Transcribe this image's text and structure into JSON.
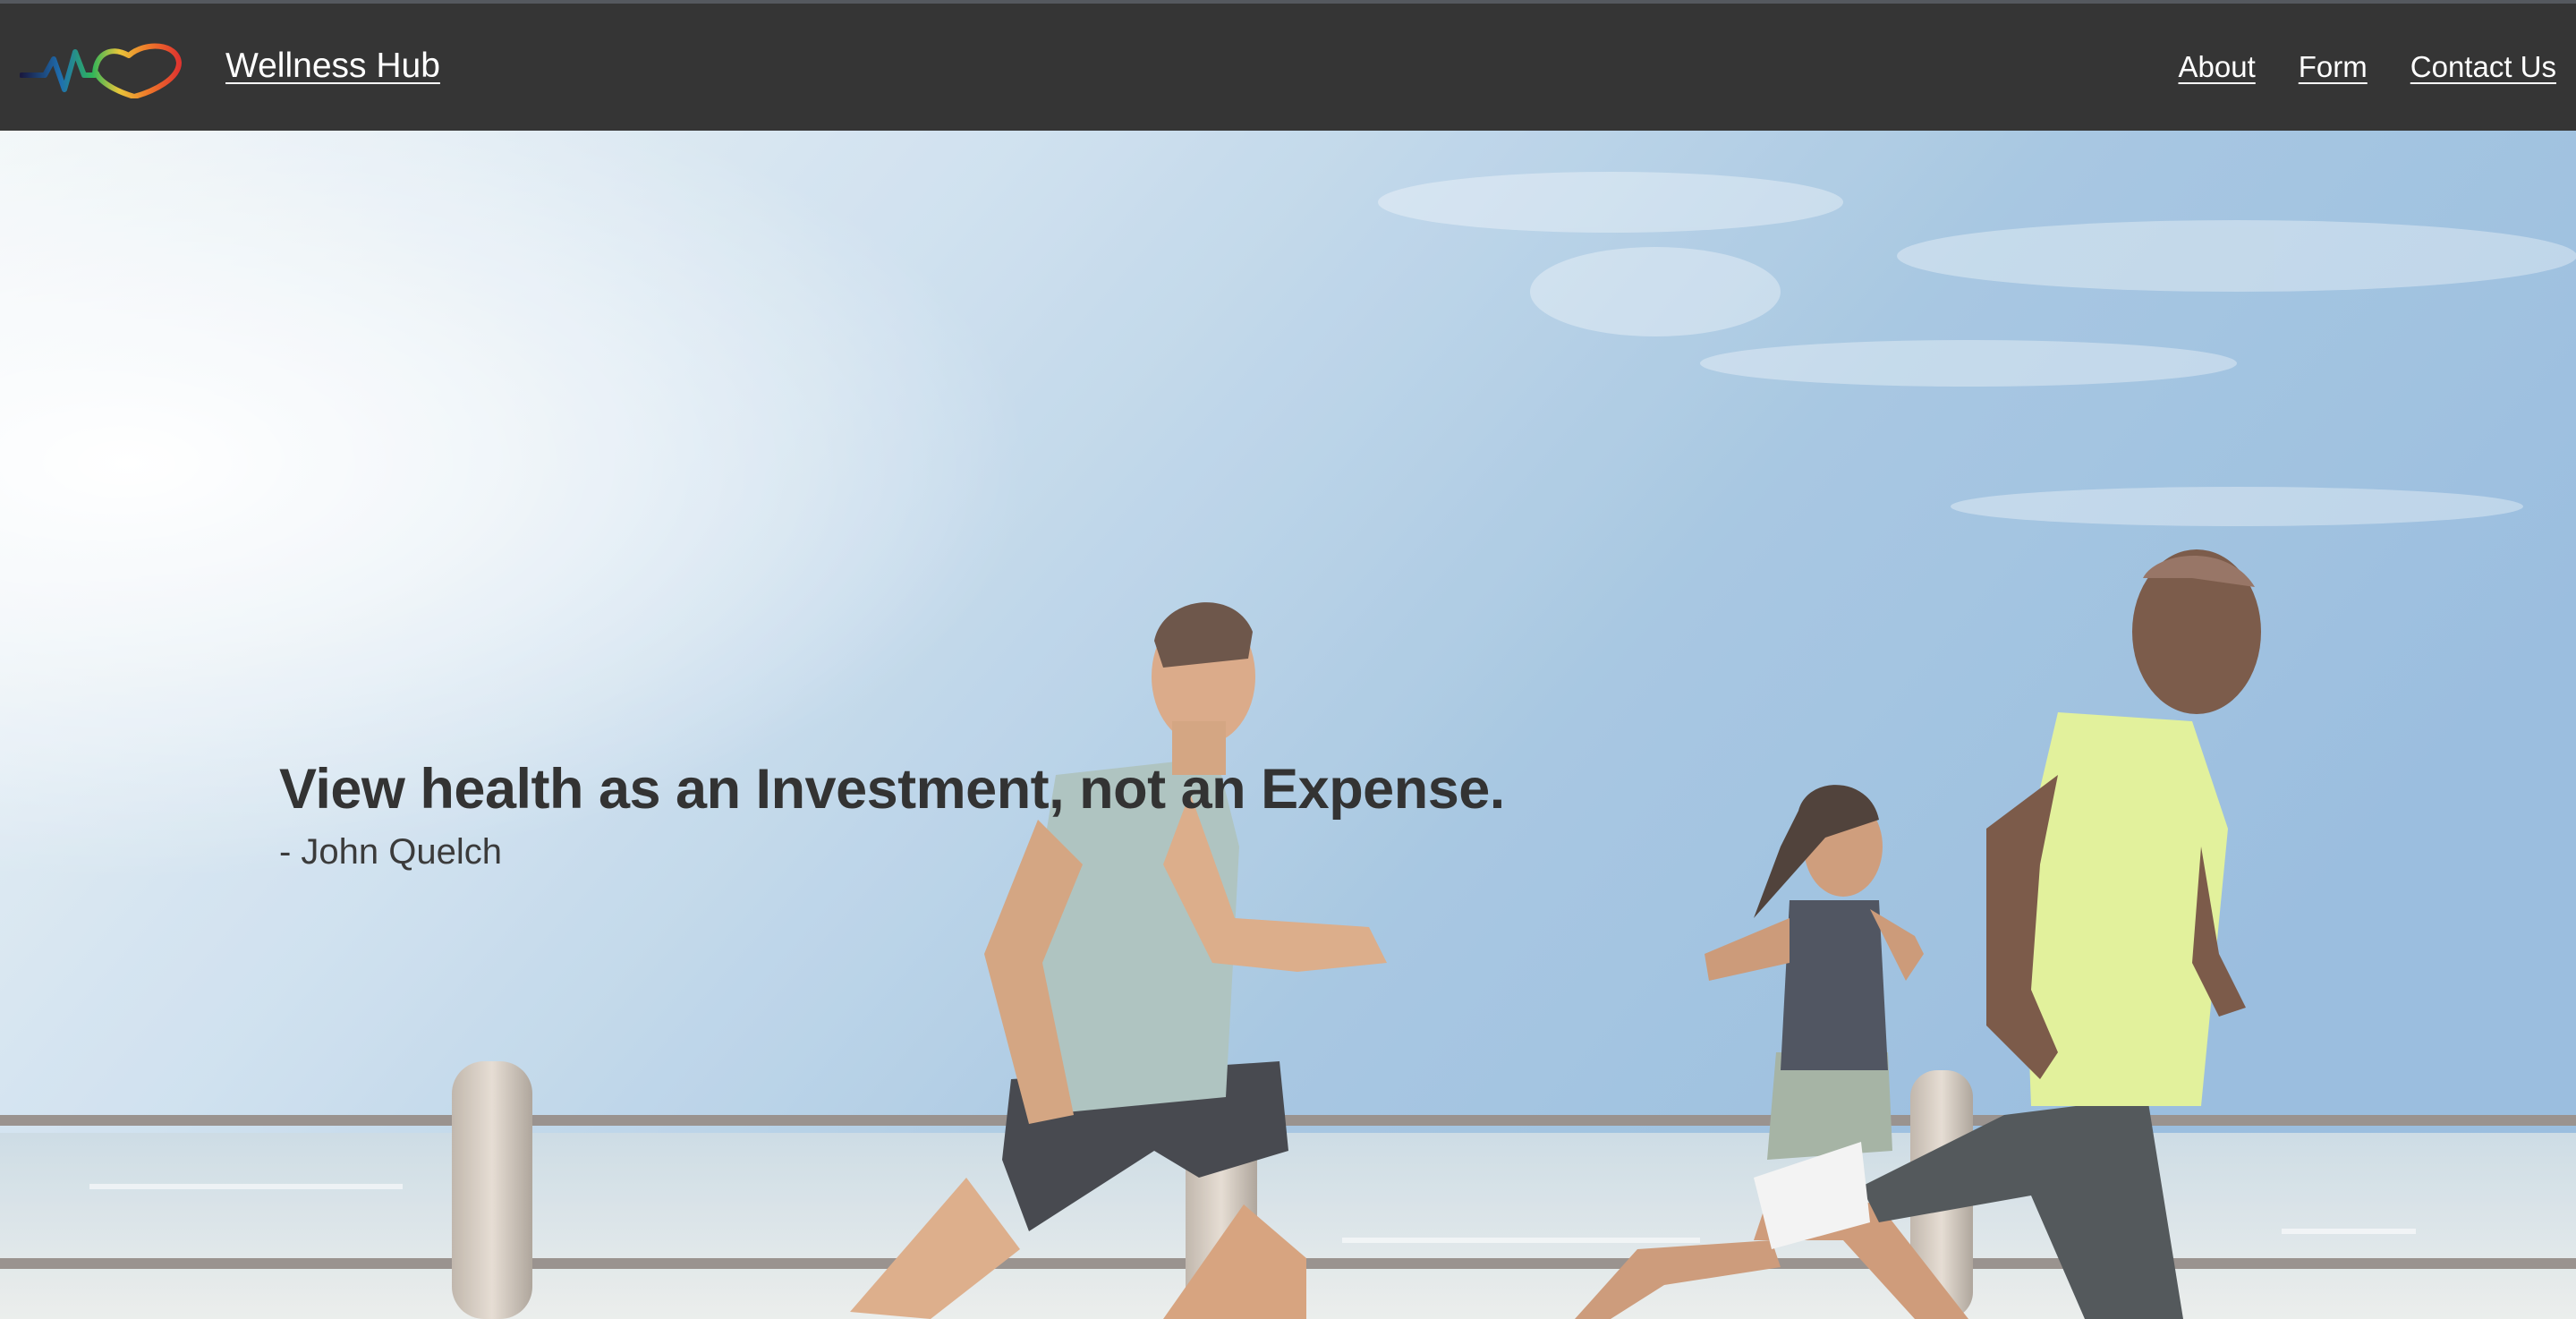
{
  "navbar": {
    "brand": "Wellness Hub",
    "logo_icon": "heartbeat-heart-logo",
    "links": [
      {
        "label": "About"
      },
      {
        "label": "Form"
      },
      {
        "label": "Contact Us"
      }
    ],
    "background": "#353535"
  },
  "hero": {
    "quote": "View health as an Investment, not an Expense.",
    "author": "- John Quelch",
    "image_description_icon": "runners-on-seaside-promenade-photo"
  }
}
